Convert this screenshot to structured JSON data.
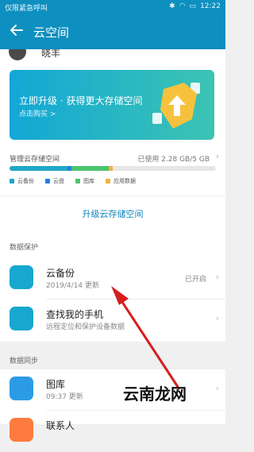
{
  "status": {
    "carrier": "仅限紧急呼叫",
    "time": "12:22"
  },
  "header": {
    "title": "云空间"
  },
  "profile": {
    "name": "晓丰"
  },
  "banner": {
    "title": "立即升级 · 获得更大存储空间",
    "subtitle": "点击购买 >"
  },
  "storage": {
    "label": "管理云存储空间",
    "used_text": "已使用 2.28 GB/5 GB",
    "used_fraction": 0.456,
    "segments": [
      {
        "name": "云备份",
        "color": "#21a7c8",
        "fraction": 0.28
      },
      {
        "name": "云盘",
        "color": "#1f7fe0",
        "fraction": 0.02
      },
      {
        "name": "图库",
        "color": "#4cc46e",
        "fraction": 0.18
      },
      {
        "name": "应用数据",
        "color": "#f0b33a",
        "fraction": 0.02
      }
    ],
    "upgrade_label": "升级云存储空间"
  },
  "sections": {
    "protection": "数据保护",
    "sync": "数据同步"
  },
  "protection_items": [
    {
      "title": "云备份",
      "subtitle": "2019/4/14 更新",
      "status": "已开启"
    },
    {
      "title": "查找我的手机",
      "subtitle": "远程定位和保护设备数据",
      "status": ""
    }
  ],
  "sync_items": [
    {
      "title": "图库",
      "subtitle": "09:37 更新",
      "status": ""
    },
    {
      "title": "联系人",
      "subtitle": "",
      "status": ""
    }
  ],
  "watermark": "云南龙网",
  "colors": {
    "brand": "#0d8fbf",
    "accent": "#0b84bd"
  }
}
